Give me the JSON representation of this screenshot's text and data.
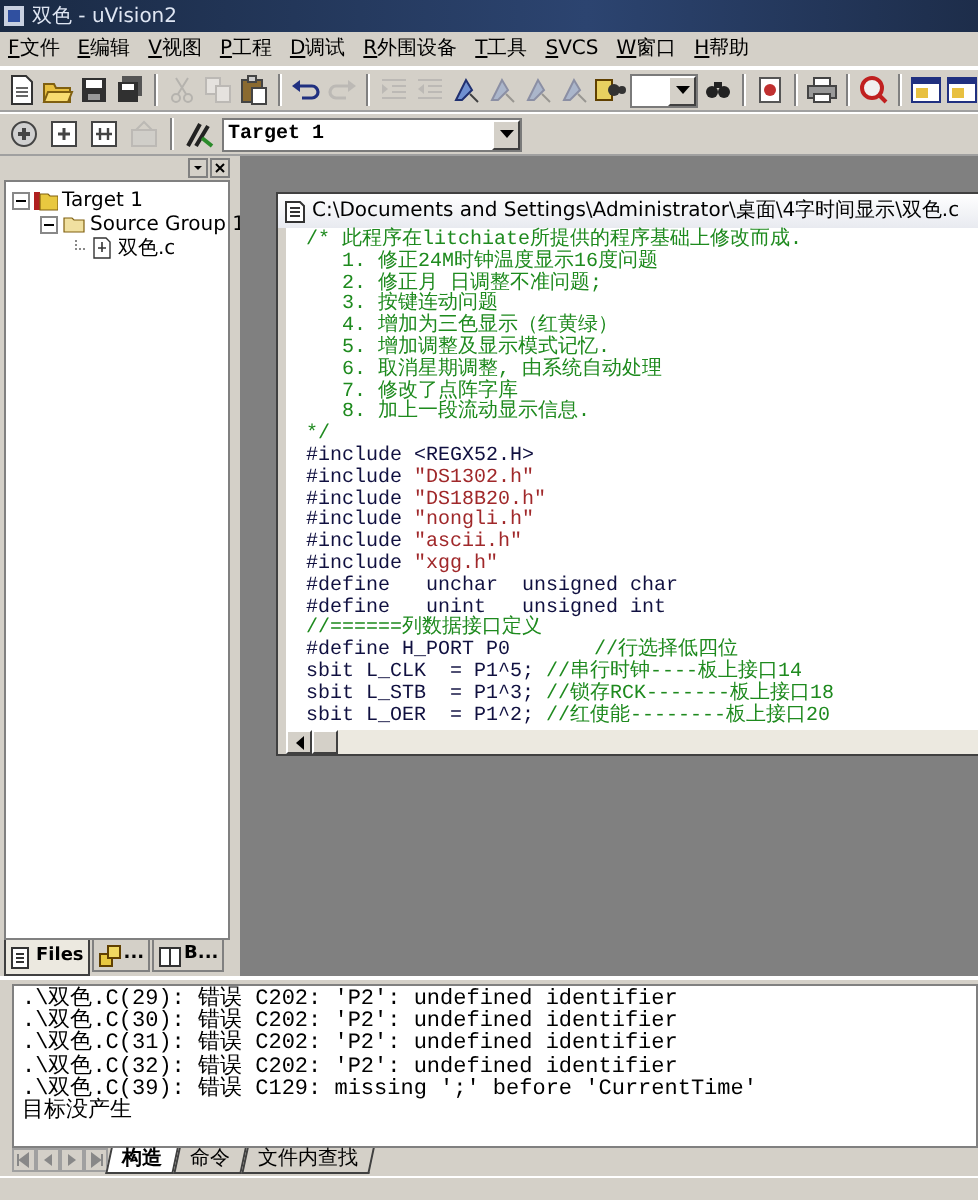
{
  "window": {
    "title": "双色 - uVision2"
  },
  "menu": [
    "F文件",
    "E编辑",
    "V视图",
    "P工程",
    "D调试",
    "R外围设备",
    "T工具",
    "SVCS",
    "W窗口",
    "H帮助"
  ],
  "toolbar": [
    {
      "kind": "new",
      "disabled": false
    },
    {
      "kind": "open",
      "disabled": false
    },
    {
      "kind": "save",
      "disabled": false
    },
    {
      "kind": "saveall",
      "disabled": false
    },
    {
      "kind": "sep"
    },
    {
      "kind": "cut",
      "disabled": true
    },
    {
      "kind": "copy",
      "disabled": true
    },
    {
      "kind": "paste",
      "disabled": false
    },
    {
      "kind": "sep"
    },
    {
      "kind": "undo",
      "disabled": false
    },
    {
      "kind": "redo",
      "disabled": true
    },
    {
      "kind": "sep"
    },
    {
      "kind": "indent",
      "disabled": true
    },
    {
      "kind": "outdent",
      "disabled": true
    },
    {
      "kind": "bookmark",
      "disabled": false
    },
    {
      "kind": "bookmark",
      "disabled": true
    },
    {
      "kind": "bookmark",
      "disabled": true
    },
    {
      "kind": "bookmark",
      "disabled": true
    },
    {
      "kind": "findfiles",
      "disabled": false
    },
    {
      "kind": "combo"
    },
    {
      "kind": "search",
      "disabled": false
    },
    {
      "kind": "sep"
    },
    {
      "kind": "doc",
      "disabled": false
    },
    {
      "kind": "sep"
    },
    {
      "kind": "print",
      "disabled": false
    },
    {
      "kind": "sep"
    },
    {
      "kind": "debug",
      "disabled": false
    },
    {
      "kind": "sep"
    },
    {
      "kind": "window",
      "disabled": false
    },
    {
      "kind": "window",
      "disabled": false
    }
  ],
  "build_toolbar": {
    "buttons": [
      {
        "kind": "compile",
        "disabled": false
      },
      {
        "kind": "build",
        "disabled": false
      },
      {
        "kind": "rebuild",
        "disabled": false
      },
      {
        "kind": "stop",
        "disabled": true
      },
      {
        "kind": "sep"
      },
      {
        "kind": "options",
        "disabled": false
      }
    ],
    "target": "Target 1"
  },
  "project_tree": [
    {
      "label": "Target 1",
      "kind": "target",
      "expanded": true,
      "children": [
        {
          "label": "Source Group 1",
          "kind": "group",
          "expanded": true,
          "children": [
            {
              "label": "双色.c",
              "kind": "file"
            }
          ]
        }
      ]
    }
  ],
  "project_tabs": [
    {
      "label": "Files",
      "kind": "files",
      "selected": true
    },
    {
      "label": "...",
      "kind": "regs",
      "selected": false
    },
    {
      "label": "B...",
      "kind": "books",
      "selected": false
    }
  ],
  "editor": {
    "title": "C:\\Documents and Settings\\Administrator\\桌面\\4字时间显示\\双色.c",
    "lines": [
      [
        {
          "kind": "comment",
          "text": "/* 此程序在litchiate所提供的程序基础上修改而成."
        }
      ],
      [
        {
          "kind": "comment",
          "text": "   1. 修正24M时钟温度显示16度问题"
        }
      ],
      [
        {
          "kind": "comment",
          "text": "   2. 修正月 日调整不准问题;"
        }
      ],
      [
        {
          "kind": "comment",
          "text": "   3. 按键连动问题"
        }
      ],
      [
        {
          "kind": "comment",
          "text": "   4. 增加为三色显示（红黄绿）"
        }
      ],
      [
        {
          "kind": "comment",
          "text": "   5. 增加调整及显示模式记忆."
        }
      ],
      [
        {
          "kind": "comment",
          "text": "   6. 取消星期调整, 由系统自动处理"
        }
      ],
      [
        {
          "kind": "comment",
          "text": "   7. 修改了点阵字库"
        }
      ],
      [
        {
          "kind": "comment",
          "text": "   8. 加上一段流动显示信息."
        }
      ],
      [
        {
          "kind": "comment",
          "text": "*/"
        }
      ],
      [
        {
          "kind": "code",
          "text": "#include <REGX52.H>"
        }
      ],
      [
        {
          "kind": "code",
          "text": "#include "
        },
        {
          "kind": "string",
          "text": "\"DS1302.h\""
        }
      ],
      [
        {
          "kind": "code",
          "text": "#include "
        },
        {
          "kind": "string",
          "text": "\"DS18B20.h\""
        }
      ],
      [
        {
          "kind": "code",
          "text": "#include "
        },
        {
          "kind": "string",
          "text": "\"nongli.h\""
        }
      ],
      [
        {
          "kind": "code",
          "text": "#include "
        },
        {
          "kind": "string",
          "text": "\"ascii.h\""
        }
      ],
      [
        {
          "kind": "code",
          "text": "#include "
        },
        {
          "kind": "string",
          "text": "\"xgg.h\""
        }
      ],
      [
        {
          "kind": "code",
          "text": "#define   unchar  unsigned char"
        }
      ],
      [
        {
          "kind": "code",
          "text": "#define   unint   unsigned int"
        }
      ],
      [
        {
          "kind": "comment",
          "text": "//======列数据接口定义"
        }
      ],
      [
        {
          "kind": "code",
          "text": "#define H_PORT P0       "
        },
        {
          "kind": "comment",
          "text": "//行选择低四位"
        }
      ],
      [
        {
          "kind": "code",
          "text": "sbit L_CLK  = P1^5; "
        },
        {
          "kind": "comment",
          "text": "//串行时钟----板上接口14"
        }
      ],
      [
        {
          "kind": "code",
          "text": "sbit L_STB  = P1^3; "
        },
        {
          "kind": "comment",
          "text": "//锁存RCK-------板上接口18"
        }
      ],
      [
        {
          "kind": "code",
          "text": "sbit L_OER  = P1^2; "
        },
        {
          "kind": "comment",
          "text": "//红使能--------板上接口20"
        }
      ]
    ]
  },
  "output": {
    "lines": [
      ".\\双色.C(29): 错误 C202: 'P2': undefined identifier",
      ".\\双色.C(30): 错误 C202: 'P2': undefined identifier",
      ".\\双色.C(31): 错误 C202: 'P2': undefined identifier",
      ".\\双色.C(32): 错误 C202: 'P2': undefined identifier",
      ".\\双色.C(39): 错误 C129: missing ';' before 'CurrentTime'",
      "目标没产生"
    ],
    "tabs": [
      {
        "label": "构造",
        "selected": true
      },
      {
        "label": "命令",
        "selected": false
      },
      {
        "label": "文件内查找",
        "selected": false
      }
    ]
  }
}
